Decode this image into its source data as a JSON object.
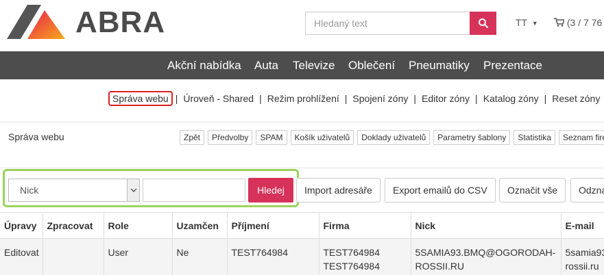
{
  "header": {
    "logo_text": "ABRA",
    "search_placeholder": "Hledaný text",
    "user_menu": "TT",
    "cart_text": "(3 / 7 76"
  },
  "nav": {
    "items": [
      "Akční nabídka",
      "Auta",
      "Televize",
      "Oblečení",
      "Pneumatiky",
      "Prezentace"
    ]
  },
  "admin_links": {
    "items": [
      "Správa webu",
      "Úroveň - Shared",
      "Režim prohlížení",
      "Spojení zóny",
      "Editor zóny",
      "Katalog zóny",
      "Reset zóny"
    ],
    "separator": "|"
  },
  "section": {
    "title": "Správa webu",
    "toolbar": [
      "Zpět",
      "Předvolby",
      "SPAM",
      "Košík uživatelů",
      "Doklady uživatelů",
      "Parametry šablony",
      "Statistika",
      "Seznam fire"
    ]
  },
  "filter": {
    "selected_field": "Nick",
    "search_value": "",
    "search_button": "Hledej",
    "actions": [
      "Import adresáře",
      "Export emailů do CSV",
      "Označit vše",
      "Odzna"
    ]
  },
  "table": {
    "columns": [
      "Úpravy",
      "Zpracovat",
      "Role",
      "Uzamčen",
      "Příjmení",
      "Firma",
      "Nick",
      "E-mail"
    ],
    "rows": [
      {
        "upravy": "Editovat",
        "zpracovat": "",
        "role": "User",
        "uzamcen": "Ne",
        "prijmeni": "TEST764984",
        "firma_1": "TEST764984",
        "firma_2": "TEST764984",
        "nick_1": "5SAMIA93.BMQ@OGORODAH-",
        "nick_2": "ROSSII.RU",
        "email_1": "5samia93",
        "email_2": "rossii.ru"
      }
    ]
  },
  "colors": {
    "accent": "#d7325a",
    "nav_bg": "#4d4d4d",
    "highlight_red": "#e02020",
    "highlight_green": "#9bd25a"
  }
}
